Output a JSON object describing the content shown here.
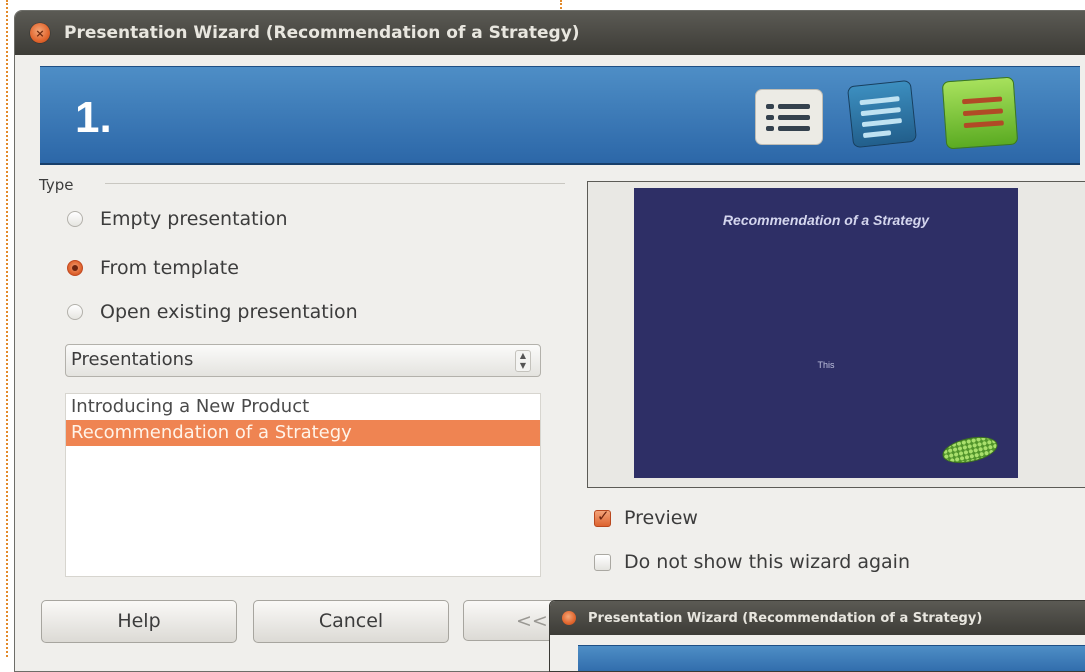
{
  "window": {
    "title": "Presentation Wizard (Recommendation of a Strategy)"
  },
  "banner": {
    "step": "1.",
    "icons": [
      "list-icon",
      "blue-list-icon",
      "green-list-icon"
    ]
  },
  "type_group": {
    "label": "Type",
    "options": [
      {
        "label": "Empty presentation",
        "checked": false
      },
      {
        "label": "From template",
        "checked": true
      },
      {
        "label": "Open existing presentation",
        "checked": false
      }
    ]
  },
  "category": {
    "selected": "Presentations"
  },
  "templates": {
    "items": [
      "Introducing a New Product",
      "Recommendation of a Strategy"
    ],
    "selected": "Recommendation of a Strategy"
  },
  "preview": {
    "slide_title": "Recommendation of a Strategy",
    "slide_subtitle": "This"
  },
  "options": {
    "preview_label": "Preview",
    "preview_checked": true,
    "dont_show_label": "Do not show this wizard again",
    "dont_show_checked": false
  },
  "buttons": {
    "help": "Help",
    "cancel": "Cancel",
    "back": "<< B"
  },
  "overlay": {
    "title": "Presentation Wizard (Recommendation of a Strategy)"
  },
  "colors": {
    "accent": "#ef8452",
    "banner": "#2c67a8",
    "titlebar": "#3d3c37",
    "slide_background": "#2e2f66"
  }
}
